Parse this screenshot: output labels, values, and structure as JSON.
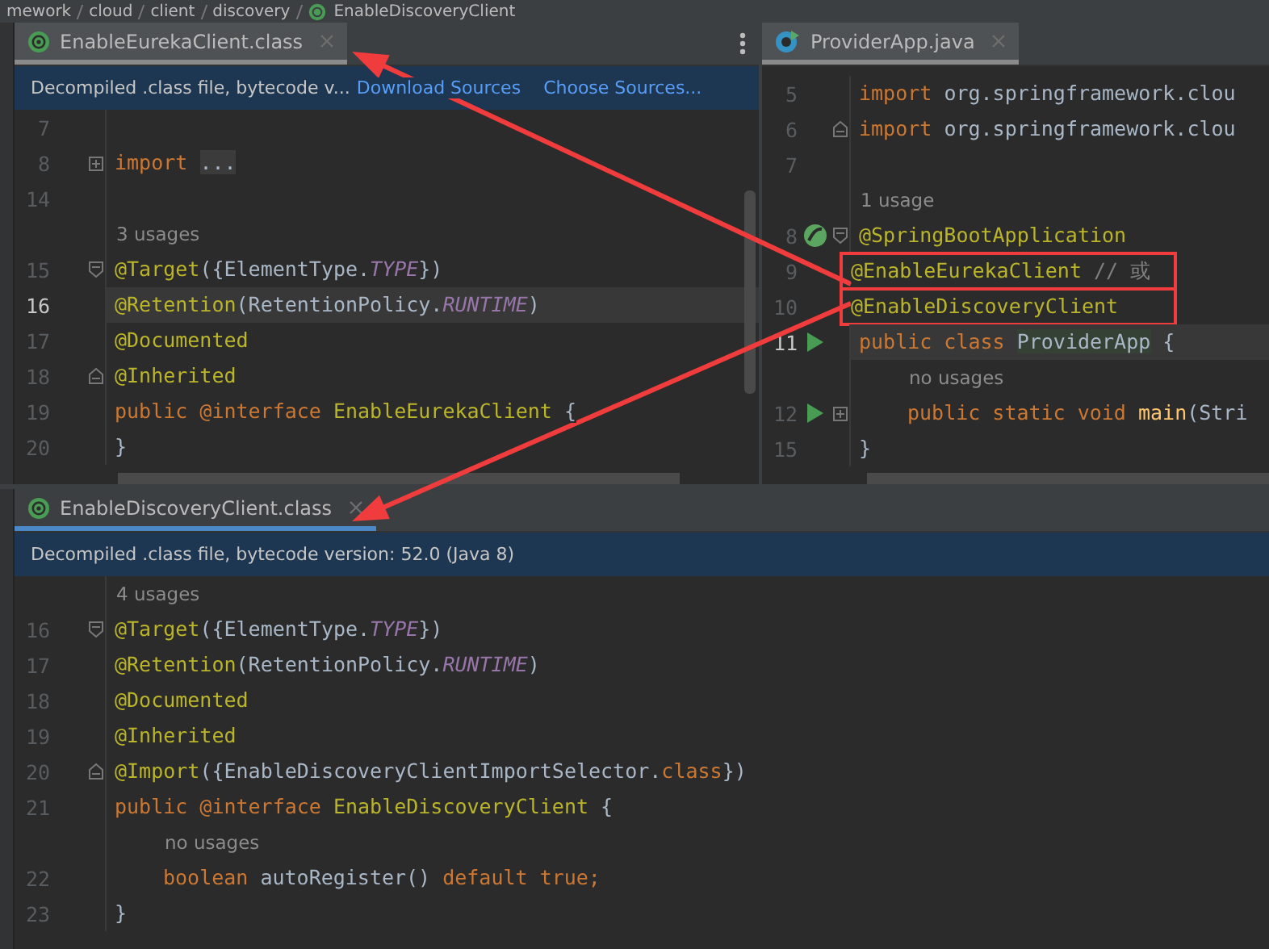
{
  "breadcrumbs": [
    "mework",
    "cloud",
    "client",
    "discovery",
    "EnableDiscoveryClient"
  ],
  "panes": [
    {
      "tab": {
        "label": "EnableEurekaClient.class",
        "kind": "class",
        "selected": true
      },
      "focused": false,
      "menu": true,
      "banner": {
        "text": "Decompiled .class file, bytecode v...",
        "links": [
          "Download Sources",
          "Choose Sources..."
        ]
      },
      "lines": [
        {
          "kind": "code",
          "number": "7",
          "current": false
        },
        {
          "kind": "code",
          "number": "8",
          "current": false,
          "markers": [
            {
              "kind": "fold-plus"
            }
          ],
          "tokens": [
            {
              "kind": "kw",
              "text": "import "
            },
            {
              "kind": "folded",
              "text": "..."
            }
          ]
        },
        {
          "kind": "code",
          "number": "14",
          "current": false
        },
        {
          "kind": "hint",
          "text": "3 usages"
        },
        {
          "kind": "code",
          "number": "15",
          "current": false,
          "markers": [
            {
              "kind": "fold-start"
            }
          ],
          "tokens": [
            {
              "kind": "ann",
              "text": "@Target"
            },
            {
              "kind": "plain",
              "text": "({ElementType."
            },
            {
              "kind": "const",
              "text": "TYPE"
            },
            {
              "kind": "plain",
              "text": "})"
            }
          ]
        },
        {
          "kind": "code",
          "number": "16",
          "current": true,
          "tokens": [
            {
              "kind": "ann",
              "text": "@Retention"
            },
            {
              "kind": "plain",
              "text": "(RetentionPolicy."
            },
            {
              "kind": "const",
              "text": "RUNTIME"
            },
            {
              "kind": "plain",
              "text": ")"
            }
          ]
        },
        {
          "kind": "code",
          "number": "17",
          "current": false,
          "tokens": [
            {
              "kind": "ann",
              "text": "@Documented"
            }
          ]
        },
        {
          "kind": "code",
          "number": "18",
          "current": false,
          "markers": [
            {
              "kind": "fold-end"
            }
          ],
          "tokens": [
            {
              "kind": "ann",
              "text": "@Inherited"
            }
          ]
        },
        {
          "kind": "code",
          "number": "19",
          "current": false,
          "tokens": [
            {
              "kind": "kw",
              "text": "public @interface "
            },
            {
              "kind": "decl",
              "text": "EnableEurekaClient"
            },
            {
              "kind": "plain",
              "text": " {"
            }
          ]
        },
        {
          "kind": "code",
          "number": "20",
          "current": false,
          "tokens": [
            {
              "kind": "plain",
              "text": "}"
            }
          ]
        }
      ]
    },
    {
      "tab": {
        "label": "ProviderApp.java",
        "kind": "java",
        "selected": true
      },
      "focused": false,
      "menu": false,
      "lines": [
        {
          "kind": "code",
          "number": "5",
          "current": false,
          "tokens": [
            {
              "kind": "kw",
              "text": "import "
            },
            {
              "kind": "plain",
              "text": "org.springframework.clou"
            }
          ]
        },
        {
          "kind": "code",
          "number": "6",
          "current": false,
          "markers": [
            {
              "kind": "fold-end"
            }
          ],
          "tokens": [
            {
              "kind": "kw",
              "text": "import "
            },
            {
              "kind": "plain",
              "text": "org.springframework.clou"
            }
          ]
        },
        {
          "kind": "code",
          "number": "7",
          "current": false
        },
        {
          "kind": "hint",
          "text": "1 usage"
        },
        {
          "kind": "code",
          "number": "8",
          "current": false,
          "markers": [
            {
              "kind": "bean"
            },
            {
              "kind": "fold-start"
            }
          ],
          "tokens": [
            {
              "kind": "ann",
              "text": "@SpringBootApplication"
            }
          ]
        },
        {
          "kind": "code",
          "number": "9",
          "current": false,
          "boxed": true,
          "tokens": [
            {
              "kind": "ann",
              "text": "@EnableEurekaClient"
            },
            {
              "kind": "comment",
              "text": " // 或"
            }
          ]
        },
        {
          "kind": "code",
          "number": "10",
          "current": false,
          "boxed": true,
          "tokens": [
            {
              "kind": "ann",
              "text": "@EnableDiscoveryClient"
            }
          ]
        },
        {
          "kind": "code",
          "number": "11",
          "current": true,
          "markers": [
            {
              "kind": "run"
            }
          ],
          "tokens": [
            {
              "kind": "kw",
              "text": "public class "
            },
            {
              "kind": "usage",
              "text": "ProviderApp"
            },
            {
              "kind": "plain",
              "text": " {"
            }
          ]
        },
        {
          "kind": "hint",
          "text": "no usages",
          "indented": true
        },
        {
          "kind": "code",
          "number": "12",
          "current": false,
          "indented": true,
          "markers": [
            {
              "kind": "run"
            },
            {
              "kind": "fold-plus"
            }
          ],
          "tokens": [
            {
              "kind": "kw",
              "text": "public static void "
            },
            {
              "kind": "method",
              "text": "main"
            },
            {
              "kind": "plain",
              "text": "(Stri"
            }
          ]
        },
        {
          "kind": "code",
          "number": "15",
          "current": false,
          "tokens": [
            {
              "kind": "plain",
              "text": "}"
            }
          ]
        }
      ]
    },
    {
      "tab": {
        "label": "EnableDiscoveryClient.class",
        "kind": "class",
        "selected": true
      },
      "focused": true,
      "menu": false,
      "banner": {
        "text": "Decompiled .class file, bytecode version: 52.0 (Java 8)"
      },
      "lines": [
        {
          "kind": "hint",
          "text": "4 usages"
        },
        {
          "kind": "code",
          "number": "16",
          "current": false,
          "markers": [
            {
              "kind": "fold-start"
            }
          ],
          "tokens": [
            {
              "kind": "ann",
              "text": "@Target"
            },
            {
              "kind": "plain",
              "text": "({ElementType."
            },
            {
              "kind": "const",
              "text": "TYPE"
            },
            {
              "kind": "plain",
              "text": "})"
            }
          ]
        },
        {
          "kind": "code",
          "number": "17",
          "current": false,
          "tokens": [
            {
              "kind": "ann",
              "text": "@Retention"
            },
            {
              "kind": "plain",
              "text": "(RetentionPolicy."
            },
            {
              "kind": "const",
              "text": "RUNTIME"
            },
            {
              "kind": "plain",
              "text": ")"
            }
          ]
        },
        {
          "kind": "code",
          "number": "18",
          "current": false,
          "tokens": [
            {
              "kind": "ann",
              "text": "@Documented"
            }
          ]
        },
        {
          "kind": "code",
          "number": "19",
          "current": false,
          "tokens": [
            {
              "kind": "ann",
              "text": "@Inherited"
            }
          ]
        },
        {
          "kind": "code",
          "number": "20",
          "current": false,
          "markers": [
            {
              "kind": "fold-end"
            }
          ],
          "tokens": [
            {
              "kind": "ann",
              "text": "@Import"
            },
            {
              "kind": "plain",
              "text": "({EnableDiscoveryClientImportSelector."
            },
            {
              "kind": "kw",
              "text": "class"
            },
            {
              "kind": "plain",
              "text": "})"
            }
          ]
        },
        {
          "kind": "code",
          "number": "21",
          "current": false,
          "tokens": [
            {
              "kind": "kw",
              "text": "public @interface "
            },
            {
              "kind": "decl",
              "text": "EnableDiscoveryClient"
            },
            {
              "kind": "plain",
              "text": " {"
            }
          ]
        },
        {
          "kind": "hint",
          "text": "no usages",
          "indented": true
        },
        {
          "kind": "code",
          "number": "22",
          "current": false,
          "indented": true,
          "tokens": [
            {
              "kind": "kw",
              "text": "boolean "
            },
            {
              "kind": "plain",
              "text": "autoRegister() "
            },
            {
              "kind": "kw",
              "text": "default true;"
            }
          ]
        },
        {
          "kind": "code",
          "number": "23",
          "current": false,
          "tokens": [
            {
              "kind": "plain",
              "text": "}"
            }
          ]
        }
      ]
    }
  ]
}
